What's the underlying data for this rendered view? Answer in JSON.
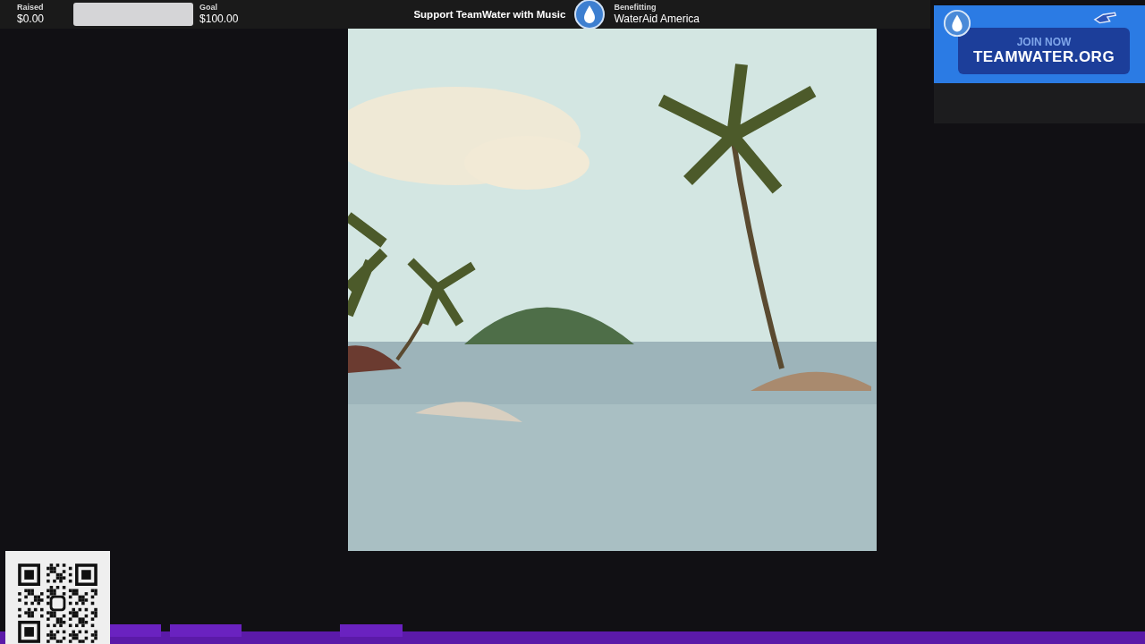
{
  "donation_bar": {
    "raised_label": "Raised",
    "raised_value": "$0.00",
    "level": 0,
    "goal_label": "Goal",
    "goal_value": "$100.00"
  },
  "campaign": {
    "title": "Support TeamWater with Music",
    "benefitting_label": "Benefitting",
    "charity": "WaterAid America"
  },
  "banner": {
    "headline": "JOIN NOW",
    "url": "TEAMWATER.ORG"
  }
}
